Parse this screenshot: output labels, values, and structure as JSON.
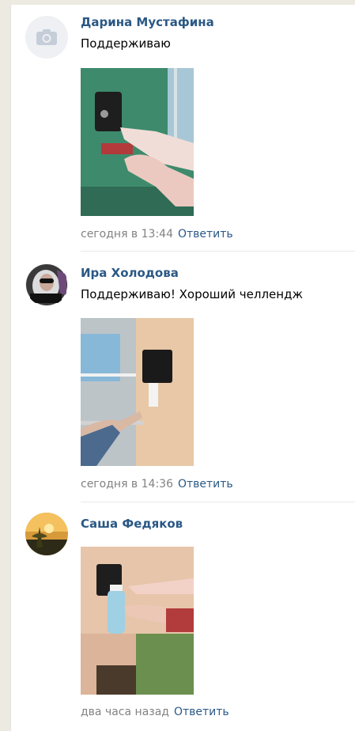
{
  "comments": [
    {
      "author": "Дарина Мустафина",
      "text": "Поддерживаю",
      "time": "сегодня в 13:44",
      "reply": "Ответить",
      "avatar": "camera-placeholder-icon"
    },
    {
      "author": "Ира Холодова",
      "text": "Поддерживаю! Хороший челлендж",
      "time": "сегодня в 14:36",
      "reply": "Ответить",
      "avatar": "user-photo"
    },
    {
      "author": "Саша Федяков",
      "text": "",
      "time": "два часа назад",
      "reply": "Ответить",
      "avatar": "landscape-photo"
    }
  ],
  "colors": {
    "link": "#2a5885",
    "meta": "#828282",
    "background": "#edeae1"
  }
}
